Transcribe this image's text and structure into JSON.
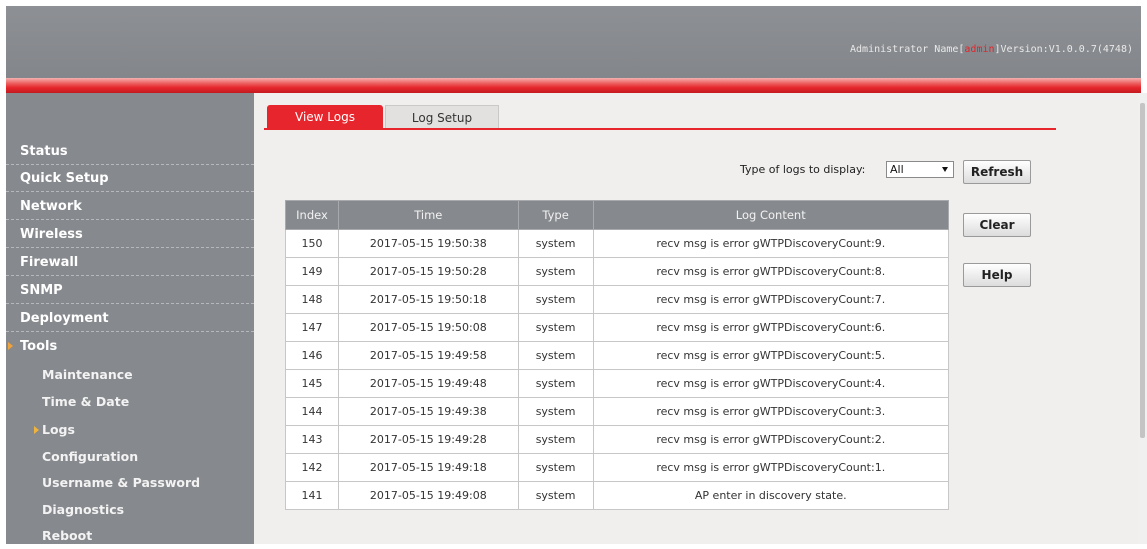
{
  "header": {
    "info_prefix": "Administrator Name[",
    "admin": "admin",
    "info_suffix": "]Version:V1.0.0.7(4748)"
  },
  "sidebar": {
    "items": [
      {
        "label": "Status"
      },
      {
        "label": "Quick Setup"
      },
      {
        "label": "Network"
      },
      {
        "label": "Wireless"
      },
      {
        "label": "Firewall"
      },
      {
        "label": "SNMP"
      },
      {
        "label": "Deployment"
      },
      {
        "label": "Tools"
      }
    ],
    "sub_items": [
      {
        "label": "Maintenance"
      },
      {
        "label": "Time & Date"
      },
      {
        "label": "Logs"
      },
      {
        "label": "Configuration"
      },
      {
        "label": "Username & Password"
      },
      {
        "label": "Diagnostics"
      },
      {
        "label": "Reboot"
      }
    ]
  },
  "tabs": {
    "view_logs": "View Logs",
    "log_setup": "Log Setup"
  },
  "filter": {
    "label": "Type of logs to display:",
    "selected": "All"
  },
  "buttons": {
    "refresh": "Refresh",
    "clear": "Clear",
    "help": "Help"
  },
  "table": {
    "headers": [
      "Index",
      "Time",
      "Type",
      "Log Content"
    ],
    "rows": [
      [
        "150",
        "2017-05-15 19:50:38",
        "system",
        "recv msg is error gWTPDiscoveryCount:9."
      ],
      [
        "149",
        "2017-05-15 19:50:28",
        "system",
        "recv msg is error gWTPDiscoveryCount:8."
      ],
      [
        "148",
        "2017-05-15 19:50:18",
        "system",
        "recv msg is error gWTPDiscoveryCount:7."
      ],
      [
        "147",
        "2017-05-15 19:50:08",
        "system",
        "recv msg is error gWTPDiscoveryCount:6."
      ],
      [
        "146",
        "2017-05-15 19:49:58",
        "system",
        "recv msg is error gWTPDiscoveryCount:5."
      ],
      [
        "145",
        "2017-05-15 19:49:48",
        "system",
        "recv msg is error gWTPDiscoveryCount:4."
      ],
      [
        "144",
        "2017-05-15 19:49:38",
        "system",
        "recv msg is error gWTPDiscoveryCount:3."
      ],
      [
        "143",
        "2017-05-15 19:49:28",
        "system",
        "recv msg is error gWTPDiscoveryCount:2."
      ],
      [
        "142",
        "2017-05-15 19:49:18",
        "system",
        "recv msg is error gWTPDiscoveryCount:1."
      ],
      [
        "141",
        "2017-05-15 19:49:08",
        "system",
        "AP enter in discovery state."
      ]
    ]
  },
  "colors": {
    "accent": "#e6262c",
    "sidebar": "#86898d",
    "content_bg": "#f0efee"
  }
}
